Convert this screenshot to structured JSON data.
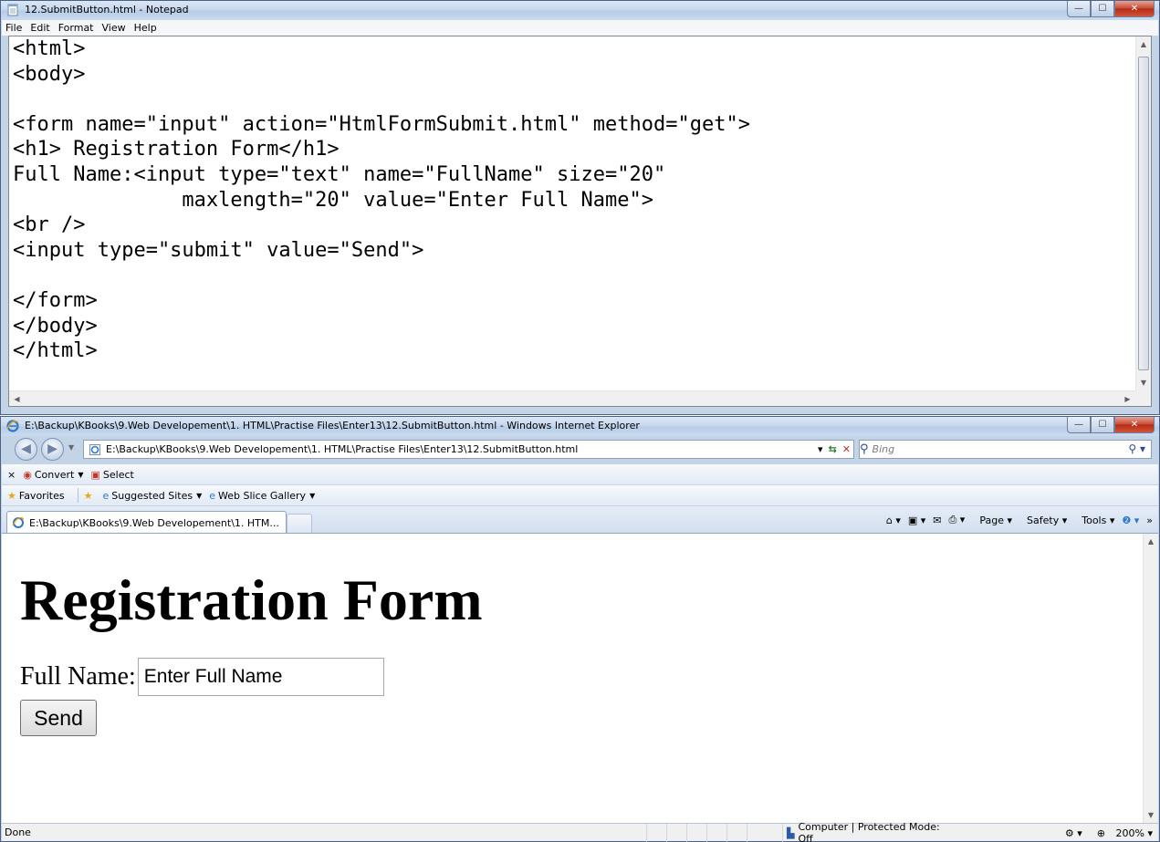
{
  "notepad": {
    "title": "12.SubmitButton.html - Notepad",
    "menu": [
      "File",
      "Edit",
      "Format",
      "View",
      "Help"
    ],
    "code": "<html>\n<body>\n\n<form name=\"input\" action=\"HtmlFormSubmit.html\" method=\"get\">\n<h1> Registration Form</h1>\nFull Name:<input type=\"text\" name=\"FullName\" size=\"20\"\n              maxlength=\"20\" value=\"Enter Full Name\">\n<br />\n<input type=\"submit\" value=\"Send\">\n\n</form>\n</body>\n</html>"
  },
  "ie": {
    "title": "E:\\Backup\\KBooks\\9.Web Developement\\1. HTML\\Practise Files\\Enter13\\12.SubmitButton.html - Windows Internet Explorer",
    "address": "E:\\Backup\\KBooks\\9.Web Developement\\1. HTML\\Practise Files\\Enter13\\12.SubmitButton.html",
    "search_placeholder": "Bing",
    "command_bar": {
      "close": "×",
      "convert": "Convert",
      "select": "Select"
    },
    "favorites_bar": {
      "favorites": "Favorites",
      "suggested": "Suggested Sites",
      "webslice": "Web Slice Gallery"
    },
    "tab_title": "E:\\Backup\\KBooks\\9.Web Developement\\1. HTM...",
    "tools": {
      "page": "Page",
      "safety": "Safety",
      "tools": "Tools"
    },
    "page": {
      "heading": "Registration Form",
      "label": "Full Name:",
      "input_value": "Enter Full Name",
      "button": "Send"
    },
    "status": {
      "text": "Done",
      "zone": "Computer | Protected Mode: Off",
      "zoom": "200%"
    }
  }
}
